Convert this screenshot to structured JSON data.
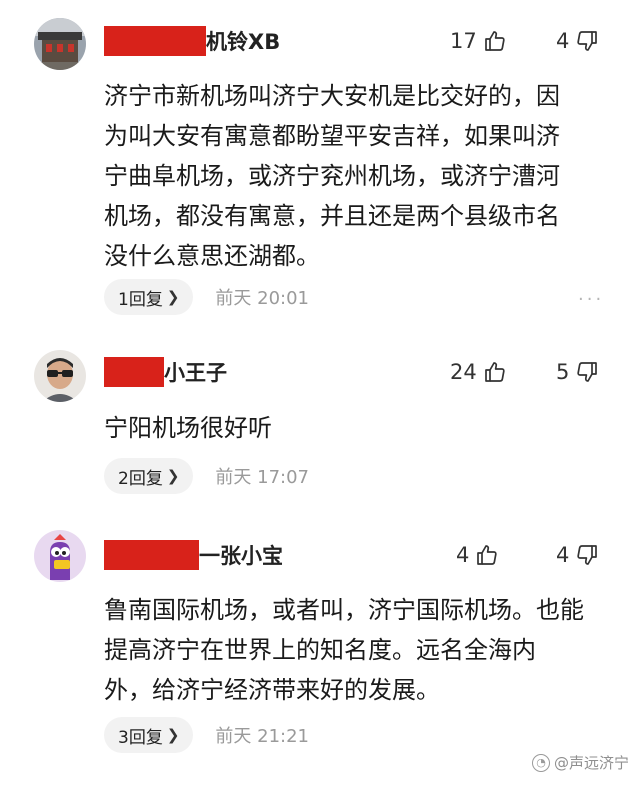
{
  "comments": [
    {
      "name_suffix": "机铃XB",
      "likes": "17",
      "dislikes": "4",
      "text": "济宁市新机场叫济宁大安机是比交好的，因\n为叫大安有寓意都盼望平安吉祥，如果叫济\n宁曲阜机场，或济宁兖州机场，或济宁漕河\n机场，都没有寓意，并且还是两个县级市名\n没什么意思还湖都。",
      "reply_label": "1回复",
      "time": "前天  20:01",
      "more": "···"
    },
    {
      "name_suffix": "小王子",
      "likes": "24",
      "dislikes": "5",
      "text": "宁阳机场很好听",
      "reply_label": "2回复",
      "time": "前天  17:07"
    },
    {
      "name_suffix": "一张小宝",
      "likes": "4",
      "dislikes": "4",
      "text": "鲁南国际机场，或者叫，济宁国际机场。也能\n提高济宁在世界上的知名度。远名全海内\n外，给济宁经济带来好的发展。",
      "reply_label": "3回复",
      "time": "前天  21:21"
    }
  ],
  "icons": {
    "like": "thumbs-up-icon",
    "dislike": "thumbs-down-icon",
    "reply_chevron": "chevron-right-icon"
  },
  "watermark": {
    "text": "@声远济宁"
  },
  "colors": {
    "redaction": "#d8221a",
    "pill_bg": "#f2f2f2",
    "muted_text": "#9a9a9a"
  }
}
